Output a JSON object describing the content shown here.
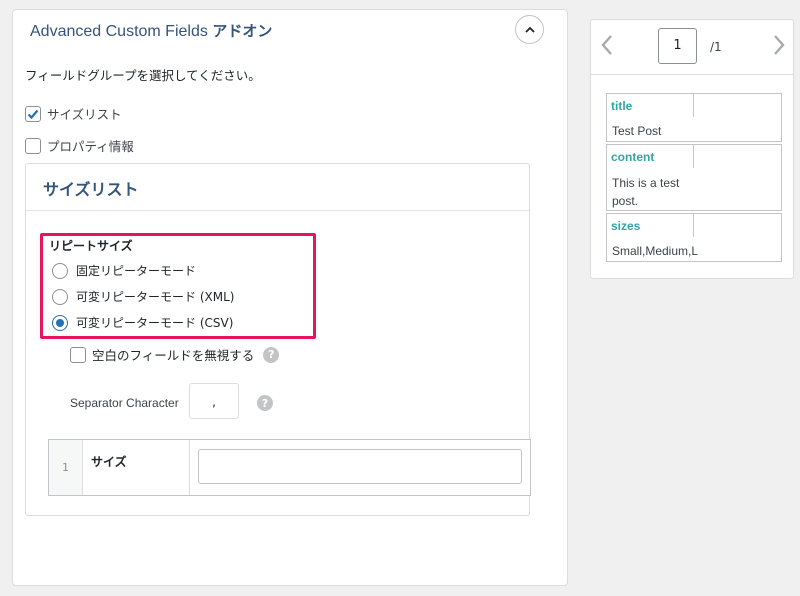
{
  "panel": {
    "title_en": "Advanced Custom Fields",
    "title_jp": "アドオン",
    "instruction": "フィールドグループを選択してください。",
    "groups": [
      {
        "label": "サイズリスト",
        "checked": true
      },
      {
        "label": "プロパティ情報",
        "checked": false
      }
    ]
  },
  "box": {
    "title": "サイズリスト",
    "repeat_label": "リピートサイズ",
    "radios": [
      {
        "label": "固定リピーターモード",
        "selected": false
      },
      {
        "label": "可変リピーターモード (XML)",
        "selected": false
      },
      {
        "label": "可変リピーターモード (CSV)",
        "selected": true
      }
    ],
    "ignore_empty_label": "空白のフィールドを無視する",
    "separator_label": "Separator Character",
    "separator_value": ",",
    "row": {
      "index": "1",
      "label": "サイズ",
      "value": ""
    }
  },
  "preview": {
    "page": "1",
    "total": "/1",
    "fields": [
      {
        "key": "title",
        "value": "Test Post"
      },
      {
        "key": "content",
        "value": "This is a test post."
      },
      {
        "key": "sizes",
        "value": "Small,Medium,Large"
      }
    ]
  },
  "colors": {
    "accent": "#2271b1",
    "highlight": "#e5145f",
    "title": "#34547c",
    "preview_key": "#35a5a0"
  }
}
